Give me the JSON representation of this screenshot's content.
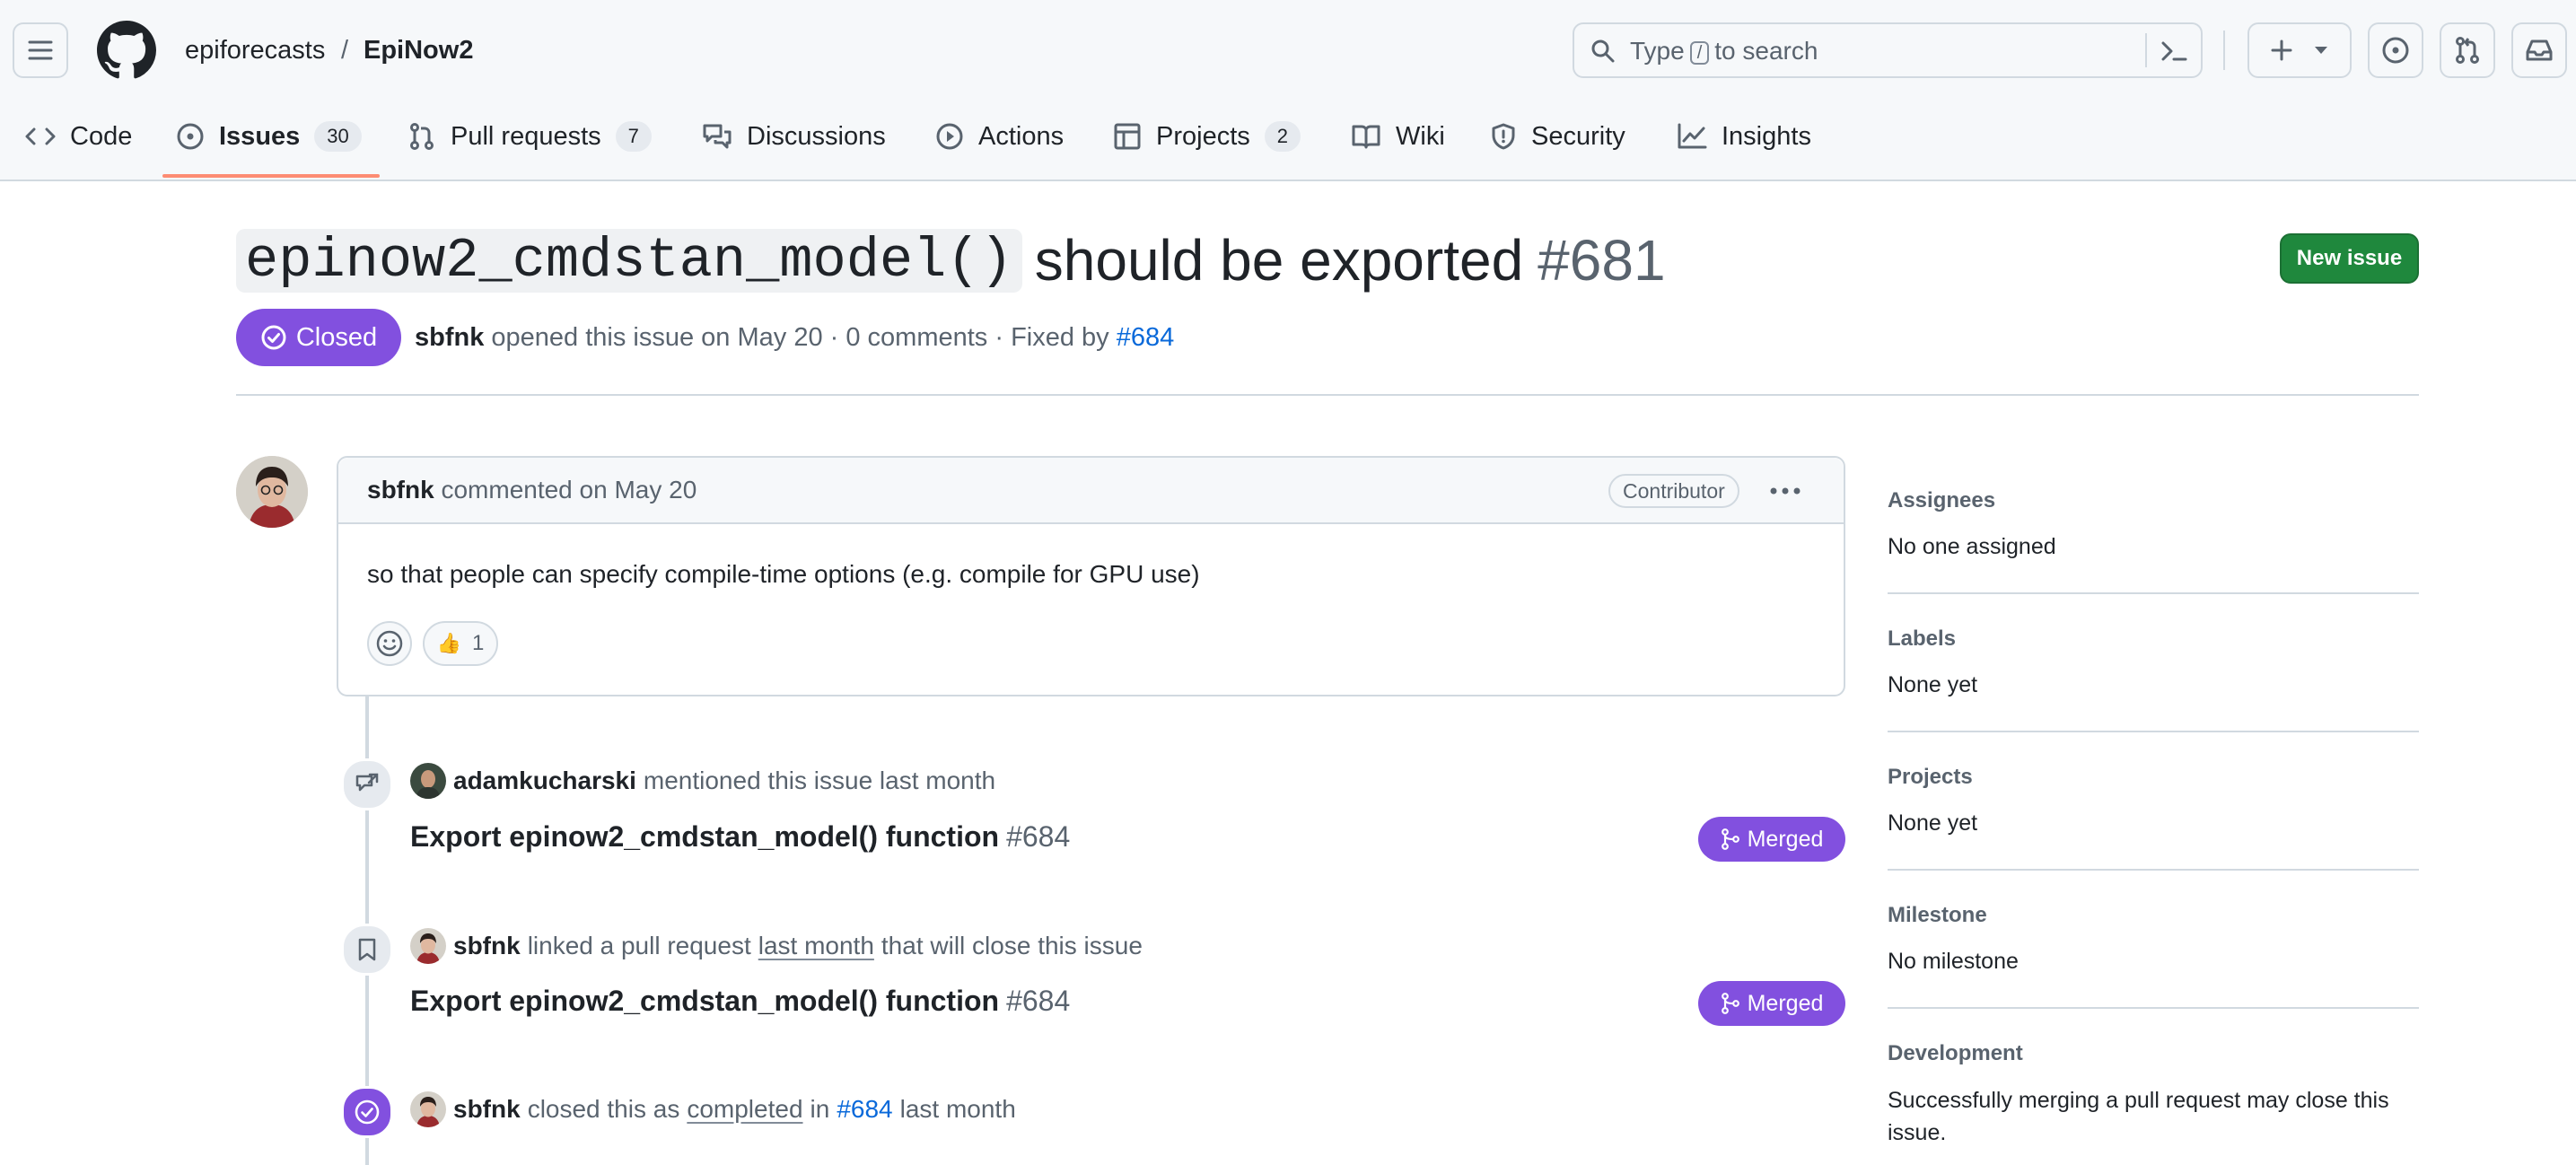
{
  "repo": {
    "owner": "epiforecasts",
    "separator": "/",
    "name": "EpiNow2"
  },
  "search": {
    "prefix": "Type",
    "key": "/",
    "suffix": "to search"
  },
  "tabs": [
    {
      "label": "Code"
    },
    {
      "label": "Issues",
      "count": "30"
    },
    {
      "label": "Pull requests",
      "count": "7"
    },
    {
      "label": "Discussions"
    },
    {
      "label": "Actions"
    },
    {
      "label": "Projects",
      "count": "2"
    },
    {
      "label": "Wiki"
    },
    {
      "label": "Security"
    },
    {
      "label": "Insights"
    }
  ],
  "issue": {
    "title_code": "epinow2_cmdstan_model()",
    "title_rest": "should be exported",
    "number": "#681",
    "state": "Closed",
    "new_issue_label": "New issue",
    "meta": {
      "author": "sbfnk",
      "opened_text": "opened this issue on May 20 · 0 comments · Fixed by",
      "fixed_by": "#684"
    }
  },
  "comment": {
    "author": "sbfnk",
    "action": "commented on May 20",
    "role": "Contributor",
    "body": "so that people can specify compile-time options (e.g. compile for GPU use)",
    "reaction": {
      "emoji": "👍",
      "count": "1"
    }
  },
  "timeline": [
    {
      "author": "adamkucharski",
      "text": "mentioned this issue last month",
      "pr_title": "Export epinow2_cmdstan_model() function",
      "pr_number": "#684",
      "badge": "Merged"
    },
    {
      "author": "sbfnk",
      "text_a": "linked a pull request",
      "link": "last month",
      "text_b": "that will close this issue",
      "pr_title": "Export epinow2_cmdstan_model() function",
      "pr_number": "#684",
      "badge": "Merged"
    },
    {
      "author": "sbfnk",
      "text_a": "closed this as",
      "link": "completed",
      "text_b": "in",
      "pr_ref": "#684",
      "text_c": "last month"
    }
  ],
  "sidebar": {
    "assignees": {
      "heading": "Assignees",
      "value": "No one assigned"
    },
    "labels": {
      "heading": "Labels",
      "value": "None yet"
    },
    "projects": {
      "heading": "Projects",
      "value": "None yet"
    },
    "milestone": {
      "heading": "Milestone",
      "value": "No milestone"
    },
    "development": {
      "heading": "Development",
      "value": "Successfully merging a pull request may close this issue."
    }
  },
  "colors": {
    "accent_purple": "#8250df",
    "green": "#1f883d",
    "link": "#0969da",
    "tab_underline": "#fd8c73"
  }
}
